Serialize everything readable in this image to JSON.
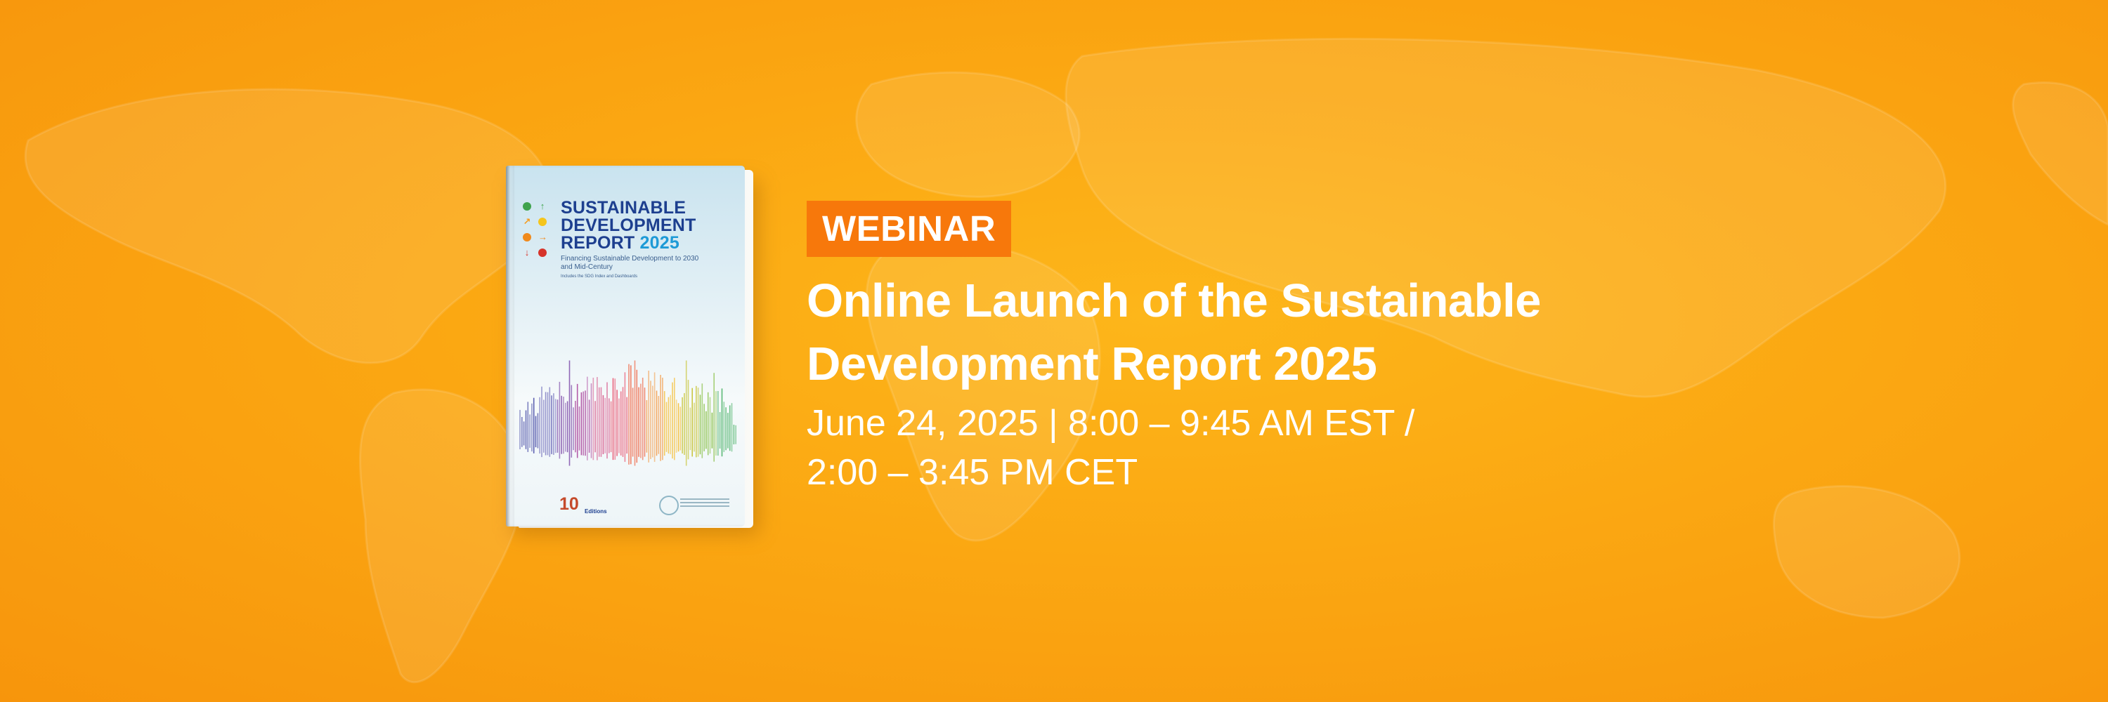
{
  "banner": {
    "badge": "WEBINAR",
    "title_lines": [
      "Online Launch of the Sustainable",
      "Development Report 2025"
    ],
    "datetime_lines": [
      "June 24, 2025 | 8:00 – 9:45 AM EST /",
      "2:00 – 3:45 PM CET"
    ],
    "colors": {
      "background": "#fba712",
      "badge_background": "#f7780b",
      "text": "#ffffff"
    }
  },
  "book_cover": {
    "title_lines": [
      "SUSTAINABLE",
      "DEVELOPMENT",
      "REPORT"
    ],
    "year": "2025",
    "subtitle": "Financing Sustainable Development to 2030 and Mid-Century",
    "tagline": "Includes the SDG Index and Dashboards",
    "edition_number": "10",
    "edition_label": "Editions",
    "icons": [
      "circle-icon",
      "arrow-up-icon",
      "arrow-diagonal-icon",
      "circle-icon",
      "circle-icon",
      "arrow-right-icon",
      "arrow-down-icon",
      "circle-icon"
    ],
    "colors": {
      "title": "#1d3f8f",
      "year": "#1e9ad6"
    }
  }
}
